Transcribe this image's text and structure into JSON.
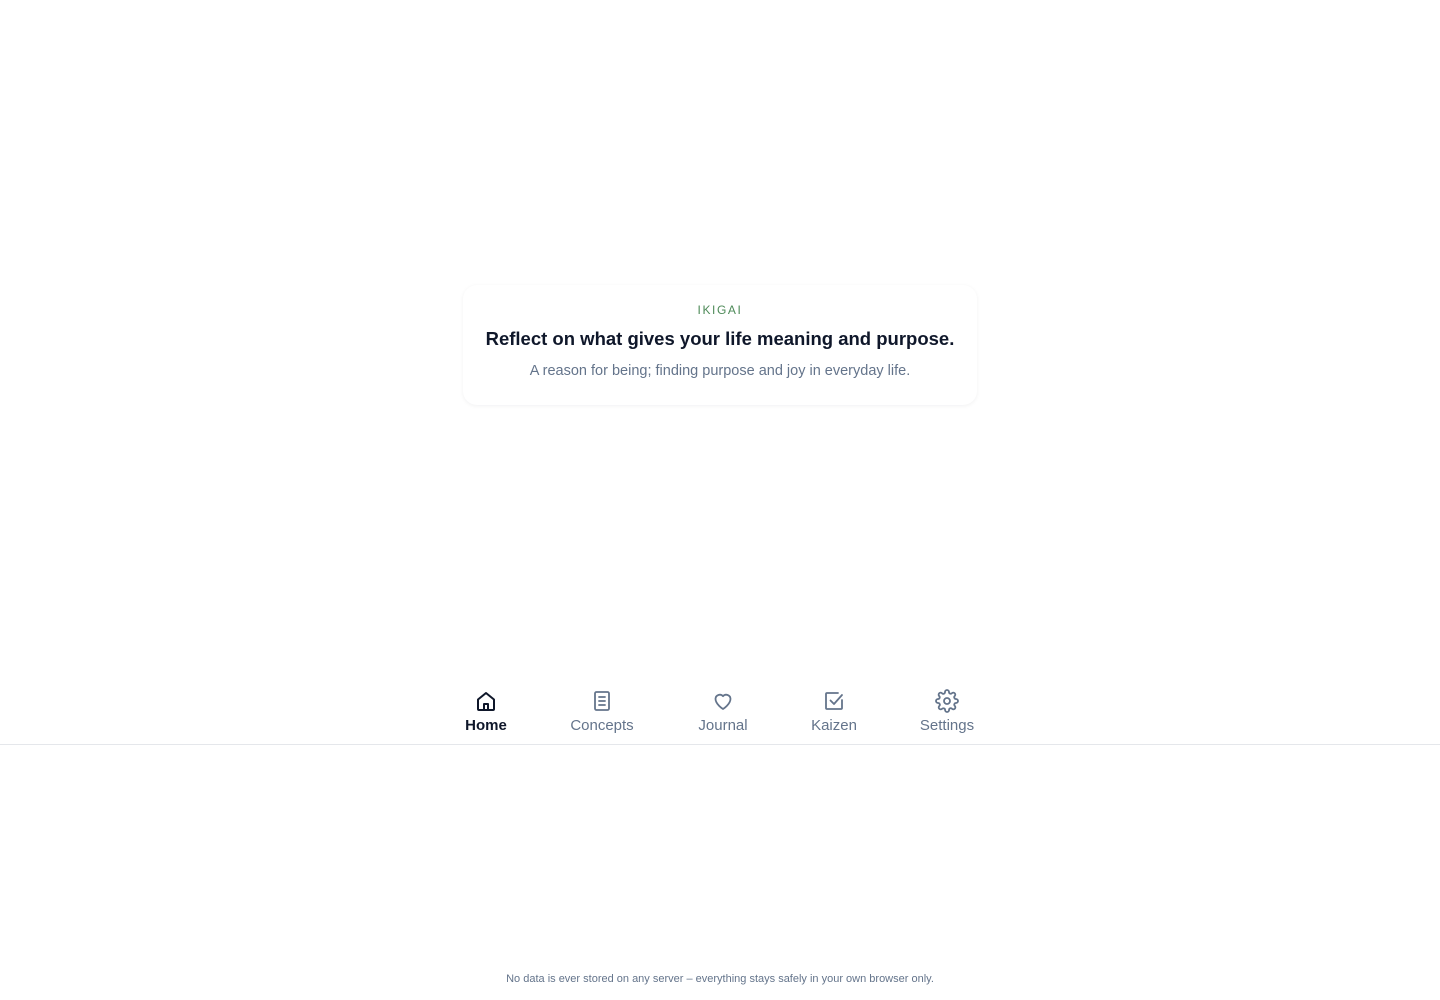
{
  "card": {
    "eyebrow": "IKIGAI",
    "title": "Reflect on what gives your life meaning and purpose.",
    "subtitle": "A reason for being; finding purpose and joy in everyday life."
  },
  "nav": {
    "active": "home",
    "items": [
      {
        "key": "home",
        "label": "Home",
        "icon": "home-icon"
      },
      {
        "key": "concepts",
        "label": "Concepts",
        "icon": "book-icon"
      },
      {
        "key": "journal",
        "label": "Journal",
        "icon": "heart-icon"
      },
      {
        "key": "kaizen",
        "label": "Kaizen",
        "icon": "checkbox-icon"
      },
      {
        "key": "settings",
        "label": "Settings",
        "icon": "gear-icon"
      }
    ]
  },
  "footer": {
    "text": "No data is ever stored on any server – everything stays safely in your own browser only."
  },
  "colors": {
    "accent": "#4d8a58",
    "text_primary": "#0f172a",
    "text_muted": "#64748b",
    "divider": "#e5e7eb"
  }
}
